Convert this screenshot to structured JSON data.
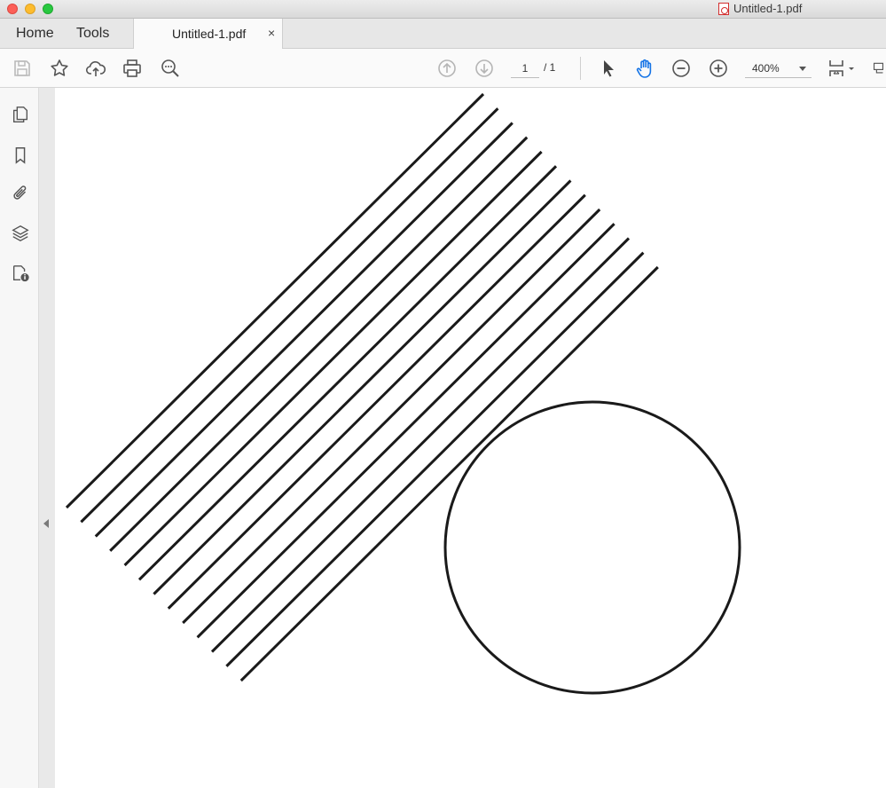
{
  "window": {
    "title": "Untitled-1.pdf"
  },
  "tabs": {
    "home_label": "Home",
    "tools_label": "Tools",
    "document_tab_label": "Untitled-1.pdf",
    "document_tab_close": "×"
  },
  "toolbar": {
    "page_current": "1",
    "page_total": "/ 1",
    "zoom": "400%"
  },
  "colors": {
    "hand_tool_active": "#1473e6",
    "drawing_stroke": "#1a1a1a"
  },
  "icons": {
    "toolbar": [
      "save-icon",
      "bookmark-star-icon",
      "cloud-upload-icon",
      "print-icon",
      "zoom-search-icon",
      "previous-page-icon",
      "next-page-icon",
      "select-arrow-icon",
      "hand-tool-icon",
      "zoom-out-icon",
      "zoom-in-icon",
      "page-display-icon",
      "more-tools-icon"
    ],
    "left_rail": [
      "page-thumbnails-icon",
      "bookmarks-icon",
      "attachments-icon",
      "layers-icon",
      "document-properties-icon"
    ]
  }
}
